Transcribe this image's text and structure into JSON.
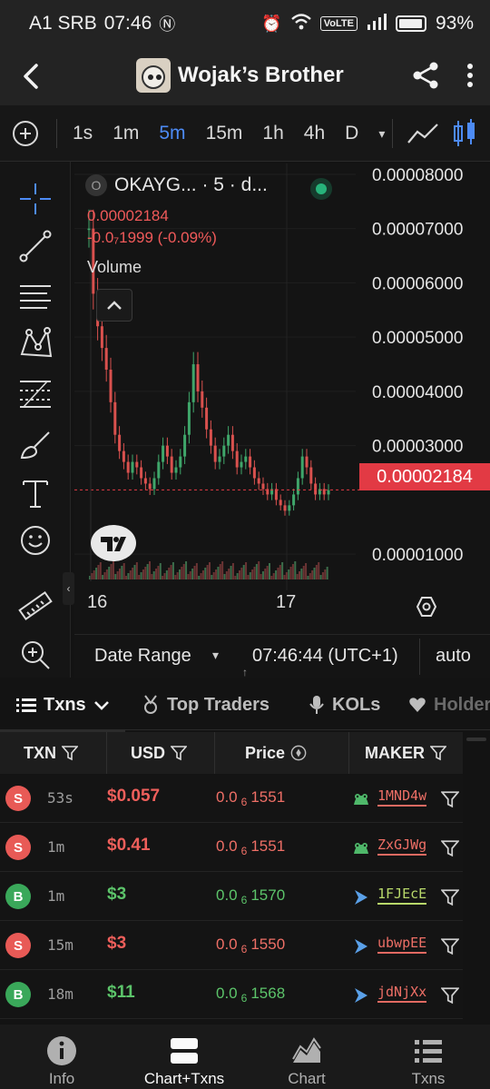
{
  "status_bar": {
    "carrier": "A1 SRB",
    "time": "07:46",
    "battery": "93%",
    "volte": "VoLTE"
  },
  "header": {
    "title": "Wojak’s Brother"
  },
  "intervals": {
    "items": [
      "1s",
      "1m",
      "5m",
      "15m",
      "1h",
      "4h",
      "D"
    ],
    "active": "5m"
  },
  "chart": {
    "symbol_label": "OKAYG... · 5 · d...",
    "symbol_badge": "O",
    "last_price": "0.00002184",
    "change": "-0.0₇1999 (-0.09%)",
    "volume_label": "Volume",
    "price_tag": "0.00002184",
    "x_labels": [
      "16",
      "17"
    ],
    "date_range_label": "Date Range",
    "time_label": "07:46:44 (UTC+1)",
    "auto_label": "auto"
  },
  "chart_data": {
    "type": "line",
    "title": "OKAYG... · 5 · d...",
    "xlabel": "",
    "ylabel": "",
    "y_ticks": [
      "0.00008000",
      "0.00007000",
      "0.00006000",
      "0.00005000",
      "0.00004000",
      "0.00003000",
      "0.00001000"
    ],
    "ylim": [
      5e-06,
      8.2e-05
    ],
    "x_ticks": [
      "16",
      "17"
    ],
    "series": [
      {
        "values": [
          7e-05,
          5.8e-05,
          5.2e-05,
          4.8e-05,
          4.4e-05,
          3.8e-05,
          3.2e-05,
          2.9e-05,
          2.7e-05,
          2.5e-05,
          2.7e-05,
          2.6e-05,
          2.4e-05,
          2.3e-05,
          2.2e-05,
          2.4e-05,
          2.7e-05,
          3e-05,
          2.8e-05,
          2.5e-05,
          2.6e-05,
          2.8e-05,
          3.2e-05,
          3.8e-05,
          4.5e-05,
          4e-05,
          3.7e-05,
          3.3e-05,
          3e-05,
          2.7e-05,
          2.8e-05,
          3e-05,
          3.2e-05,
          2.9e-05,
          2.6e-05,
          2.7e-05,
          2.8e-05,
          2.6e-05,
          2.4e-05,
          2.3e-05,
          2.2e-05,
          2.1e-05,
          2.2e-05,
          2e-05,
          1.9e-05,
          1.8e-05,
          1.9e-05,
          2.1e-05,
          2.4e-05,
          2.8e-05,
          2.6e-05,
          2.3e-05,
          2.1e-05,
          2.2e-05,
          2.1e-05,
          2.18e-05
        ]
      }
    ],
    "reference_line": 2.184e-05,
    "grid": true
  },
  "tabs": [
    {
      "label": "Txns",
      "icon": "list-icon",
      "active": true
    },
    {
      "label": "Top Traders",
      "icon": "medal-icon"
    },
    {
      "label": "KOLs",
      "icon": "mic-icon"
    },
    {
      "label": "Holders",
      "icon": "heart-icon"
    }
  ],
  "table": {
    "headers": {
      "txn": "TXN",
      "usd": "USD",
      "price": "Price",
      "maker": "MAKER"
    },
    "rows": [
      {
        "side": "S",
        "type": "sell",
        "age": "53s",
        "usd": "$0.057",
        "price_a": "0.0",
        "price_sub": "6",
        "price_b": "1551",
        "maker": "1MND4w",
        "maker_icon": "frog-icon"
      },
      {
        "side": "S",
        "type": "sell",
        "age": "1m",
        "usd": "$0.41",
        "price_a": "0.0",
        "price_sub": "6",
        "price_b": "1551",
        "maker": "ZxGJWg",
        "maker_icon": "frog-icon"
      },
      {
        "side": "B",
        "type": "buy",
        "age": "1m",
        "usd": "$3",
        "price_a": "0.0",
        "price_sub": "6",
        "price_b": "1570",
        "maker": "1FJEcE",
        "maker_icon": "arrow-icon"
      },
      {
        "side": "S",
        "type": "sell",
        "age": "15m",
        "usd": "$3",
        "price_a": "0.0",
        "price_sub": "6",
        "price_b": "1550",
        "maker": "ubwpEE",
        "maker_icon": "arrow-icon"
      },
      {
        "side": "B",
        "type": "buy",
        "age": "18m",
        "usd": "$11",
        "price_a": "0.0",
        "price_sub": "6",
        "price_b": "1568",
        "maker": "jdNjXx",
        "maker_icon": "arrow-icon"
      }
    ]
  },
  "bottom_nav": [
    {
      "label": "Info",
      "icon": "info-icon"
    },
    {
      "label": "Chart+Txns",
      "icon": "split-view-icon",
      "active": true
    },
    {
      "label": "Chart",
      "icon": "area-chart-icon"
    },
    {
      "label": "Txns",
      "icon": "list-icon"
    }
  ],
  "colors": {
    "accent": "#4d8bf5",
    "sell": "#ee5f5b",
    "buy": "#5cc46a",
    "price_tag": "#e23a44"
  }
}
